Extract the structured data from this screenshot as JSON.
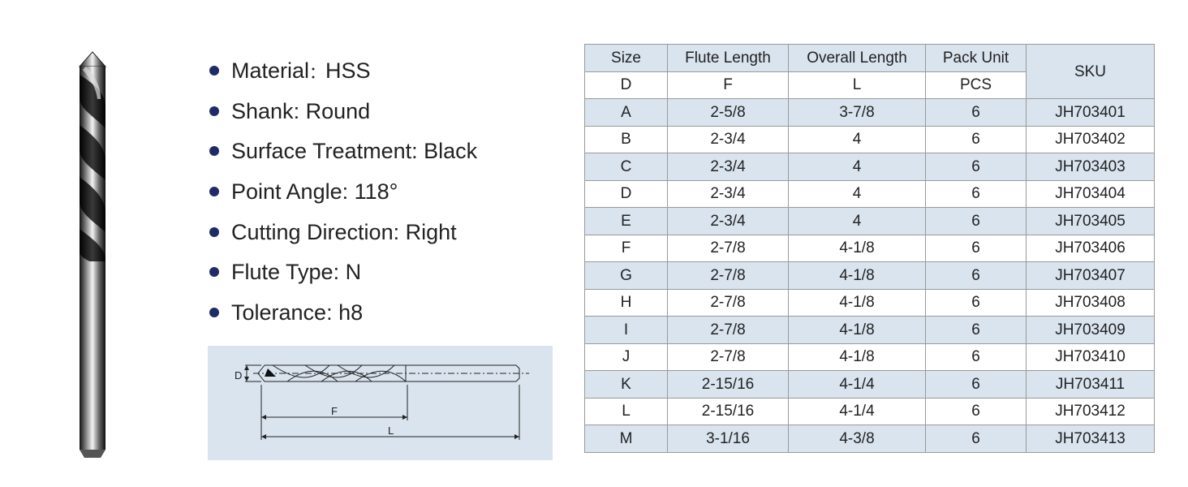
{
  "specs": [
    {
      "label": "Material",
      "sep": "：",
      "value": "HSS"
    },
    {
      "label": "Shank",
      "sep": ": ",
      "value": "Round"
    },
    {
      "label": "Surface Treatment",
      "sep": ": ",
      "value": "Black"
    },
    {
      "label": "Point Angle",
      "sep": ": ",
      "value": "118°"
    },
    {
      "label": "Cutting Direction",
      "sep": ": ",
      "value": "Right"
    },
    {
      "label": "Flute Type",
      "sep": ": ",
      "value": "N"
    },
    {
      "label": "Tolerance",
      "sep": ": ",
      "value": "h8"
    }
  ],
  "diagram": {
    "d_label": "D",
    "f_label": "F",
    "l_label": "L"
  },
  "table": {
    "headers": {
      "size": "Size",
      "flute": "Flute Length",
      "overall": "Overall Length",
      "pack": "Pack Unit",
      "sku": "SKU"
    },
    "units": {
      "size": "D",
      "flute": "F",
      "overall": "L",
      "pack": "PCS"
    },
    "rows": [
      {
        "size": "A",
        "flute": "2-5/8",
        "overall": "3-7/8",
        "pack": "6",
        "sku": "JH703401"
      },
      {
        "size": "B",
        "flute": "2-3/4",
        "overall": "4",
        "pack": "6",
        "sku": "JH703402"
      },
      {
        "size": "C",
        "flute": "2-3/4",
        "overall": "4",
        "pack": "6",
        "sku": "JH703403"
      },
      {
        "size": "D",
        "flute": "2-3/4",
        "overall": "4",
        "pack": "6",
        "sku": "JH703404"
      },
      {
        "size": "E",
        "flute": "2-3/4",
        "overall": "4",
        "pack": "6",
        "sku": "JH703405"
      },
      {
        "size": "F",
        "flute": "2-7/8",
        "overall": "4-1/8",
        "pack": "6",
        "sku": "JH703406"
      },
      {
        "size": "G",
        "flute": "2-7/8",
        "overall": "4-1/8",
        "pack": "6",
        "sku": "JH703407"
      },
      {
        "size": "H",
        "flute": "2-7/8",
        "overall": "4-1/8",
        "pack": "6",
        "sku": "JH703408"
      },
      {
        "size": "I",
        "flute": "2-7/8",
        "overall": "4-1/8",
        "pack": "6",
        "sku": "JH703409"
      },
      {
        "size": "J",
        "flute": "2-7/8",
        "overall": "4-1/8",
        "pack": "6",
        "sku": "JH703410"
      },
      {
        "size": "K",
        "flute": "2-15/16",
        "overall": "4-1/4",
        "pack": "6",
        "sku": "JH703411"
      },
      {
        "size": "L",
        "flute": "2-15/16",
        "overall": "4-1/4",
        "pack": "6",
        "sku": "JH703412"
      },
      {
        "size": "M",
        "flute": "3-1/16",
        "overall": "4-3/8",
        "pack": "6",
        "sku": "JH703413"
      }
    ]
  },
  "colors": {
    "accent_fill": "#d9e4ef",
    "bullet": "#1f2b66",
    "grid_line": "#9a9a9a"
  }
}
